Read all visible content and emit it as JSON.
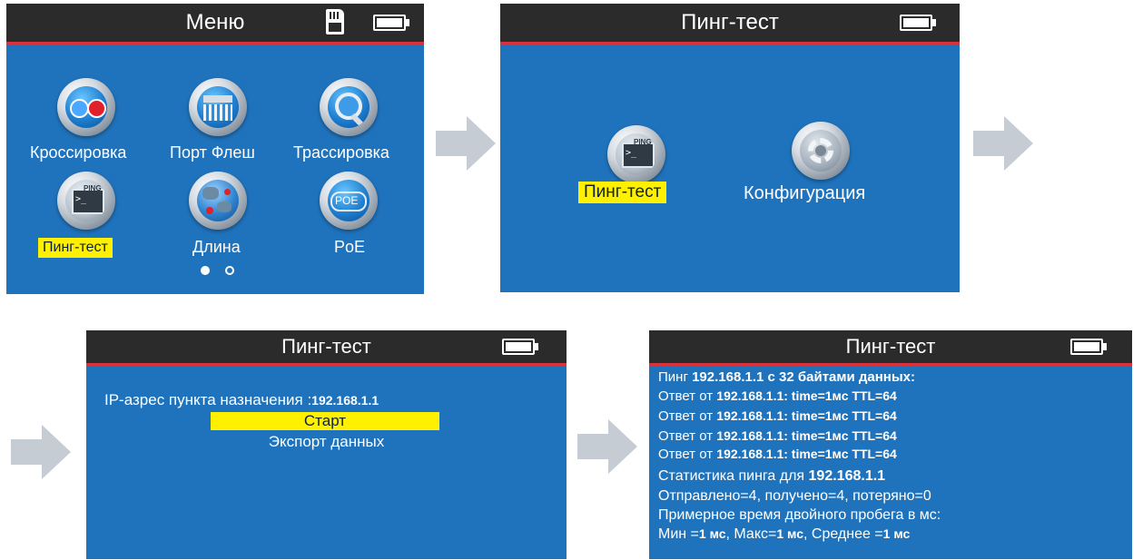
{
  "screen1": {
    "title": "Меню",
    "items": [
      {
        "label": "Кроссировка"
      },
      {
        "label": "Порт Флеш"
      },
      {
        "label": "Трассировка"
      },
      {
        "label": "Пинг-тест"
      },
      {
        "label": "Длина"
      },
      {
        "label": "PoE"
      }
    ],
    "ping_icon_text": "PING",
    "poe_icon_text": "POE",
    "page_indicator": {
      "current": 1,
      "total": 2
    }
  },
  "screen2": {
    "title": "Пинг-тест",
    "items": [
      {
        "label": "Пинг-тест"
      },
      {
        "label": "Конфигурация"
      }
    ],
    "ping_icon_text": "PING"
  },
  "screen3": {
    "title": "Пинг-тест",
    "ip_label": "IP-азрес пункта назначения :",
    "ip_value": "192.168.1.1",
    "start": "Старт",
    "export": "Экспорт данных"
  },
  "screen4": {
    "title": "Пинг-тест",
    "ping_prefix": "Пинг ",
    "ping_target": "192.168.1.1 с 32 байтами данных:",
    "replies": [
      {
        "prefix": "Ответ от ",
        "value": "192.168.1.1: time=1мс TTL=64"
      },
      {
        "prefix": "Ответ от ",
        "value": "192.168.1.1: time=1мс TTL=64"
      },
      {
        "prefix": "Ответ от ",
        "value": "192.168.1.1: time=1мс TTL=64"
      },
      {
        "prefix": "Ответ от ",
        "value": "192.168.1.1: time=1мс TTL=64"
      }
    ],
    "stats_prefix": "Статистика пинга для ",
    "stats_ip": "192.168.1.1",
    "sent_line": "Отправлено=4, получено=4, потеряно=0",
    "rtt_line": "Примерное время двойного пробега в мс:",
    "min_label": "Мин =",
    "min_value": "1 мс",
    "max_label": ", Макс=",
    "max_value": "1 мс",
    "avg_label": ", Среднее =",
    "avg_value": "1 мс"
  },
  "colors": {
    "screen_bg": "#1f73bd",
    "titlebar": "#2b2b2b",
    "title_accent": "#d8323c",
    "highlight": "#fff000",
    "arrow": "#c6ccd4"
  }
}
